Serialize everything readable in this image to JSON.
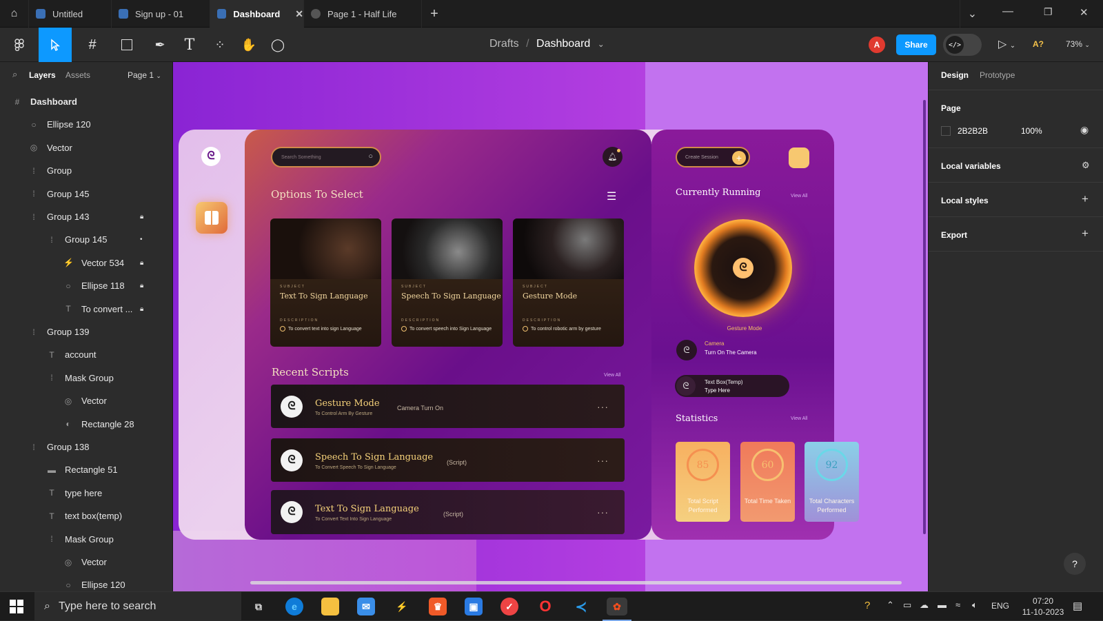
{
  "tabs": [
    {
      "label": "Untitled"
    },
    {
      "label": "Sign up - 01"
    },
    {
      "label": "Dashboard"
    },
    {
      "label": "Page 1 - Half Life"
    }
  ],
  "breadcrumb": {
    "parent": "Drafts",
    "current": "Dashboard"
  },
  "toolbar": {
    "share_label": "Share",
    "avatar_initial": "A",
    "font_hint": "A?",
    "zoom": "73%"
  },
  "left_panel": {
    "tabs": [
      "Layers",
      "Assets"
    ],
    "page_selector": "Page 1",
    "layers": [
      {
        "name": "Dashboard",
        "icon": "#"
      },
      {
        "name": "Ellipse 120",
        "icon": "○"
      },
      {
        "name": "Vector",
        "icon": "◎"
      },
      {
        "name": "Group",
        "icon": "⁞"
      },
      {
        "name": "Group 145",
        "icon": "⁞"
      },
      {
        "name": "Group 143",
        "icon": "⁞"
      },
      {
        "name": "Group 145",
        "icon": "⁞"
      },
      {
        "name": "Vector 534",
        "icon": "⚡"
      },
      {
        "name": "Ellipse 118",
        "icon": "○"
      },
      {
        "name": "To convert ...",
        "icon": "T"
      },
      {
        "name": "Group 139",
        "icon": "⁞"
      },
      {
        "name": "account",
        "icon": "T"
      },
      {
        "name": "Mask Group",
        "icon": "⁞"
      },
      {
        "name": "Vector",
        "icon": "◎"
      },
      {
        "name": "Rectangle 28",
        "icon": "◐"
      },
      {
        "name": "Group 138",
        "icon": "⁞"
      },
      {
        "name": "Rectangle 51",
        "icon": "▬"
      },
      {
        "name": "type here",
        "icon": "T"
      },
      {
        "name": "text box(temp)",
        "icon": "T"
      },
      {
        "name": "Mask Group",
        "icon": "⁞"
      },
      {
        "name": "Vector",
        "icon": "◎"
      },
      {
        "name": "Ellipse 120",
        "icon": "○"
      }
    ]
  },
  "right_panel": {
    "tabs": [
      "Design",
      "Prototype"
    ],
    "page_heading": "Page",
    "page_color": "2B2B2B",
    "page_opacity": "100%",
    "local_variables": "Local variables",
    "local_styles": "Local styles",
    "export": "Export"
  },
  "dashboard": {
    "search_placeholder": "Search Something",
    "options_title": "Options To Select",
    "cards": [
      {
        "subject_label": "SUBJECT",
        "title": "Text To Sign Language",
        "desc_label": "DESCRIPTION",
        "desc": "To convert text into sign Language"
      },
      {
        "subject_label": "SUBJECT",
        "title": "Speech To Sign Language",
        "desc_label": "DESCRIPTION",
        "desc": "To convert speech into Sign Language"
      },
      {
        "subject_label": "SUBJECT",
        "title": "Gesture Mode",
        "desc_label": "DESCRIPTION",
        "desc": "To control robotic arm by gesture"
      }
    ],
    "recent_title": "Recent Scripts",
    "view_all": "View All",
    "scripts": [
      {
        "title": "Gesture Mode",
        "subtitle": "To Control Arm By Gesture",
        "tag": "Camera Turn On"
      },
      {
        "title": "Speech To Sign Language",
        "subtitle": "To Convert Speech To Sign Language",
        "tag": "(Script)"
      },
      {
        "title": "Text To Sign Language",
        "subtitle": "To Convert Text Into Sign Language",
        "tag": "(Script)"
      }
    ],
    "create_session": "Create Session",
    "currently_running": "Currently Running",
    "running_mode": "Gesture Mode",
    "running_items": [
      {
        "title": "Camera",
        "subtitle": "Turn On The Camera"
      },
      {
        "title": "Text Box(Temp)",
        "subtitle": "Type Here"
      }
    ],
    "statistics_title": "Statistics",
    "stats": [
      {
        "value": "85",
        "label": "Total Script Performed",
        "color": "#f5c061"
      },
      {
        "value": "60",
        "label": "Total Time Taken",
        "color": "#f07a5a"
      },
      {
        "value": "92",
        "label": "Total Characters Performed",
        "color": "#7fc3e0"
      }
    ]
  },
  "taskbar": {
    "search_placeholder": "Type here to search",
    "language": "ENG",
    "time": "07:20",
    "date": "11-10-2023"
  }
}
